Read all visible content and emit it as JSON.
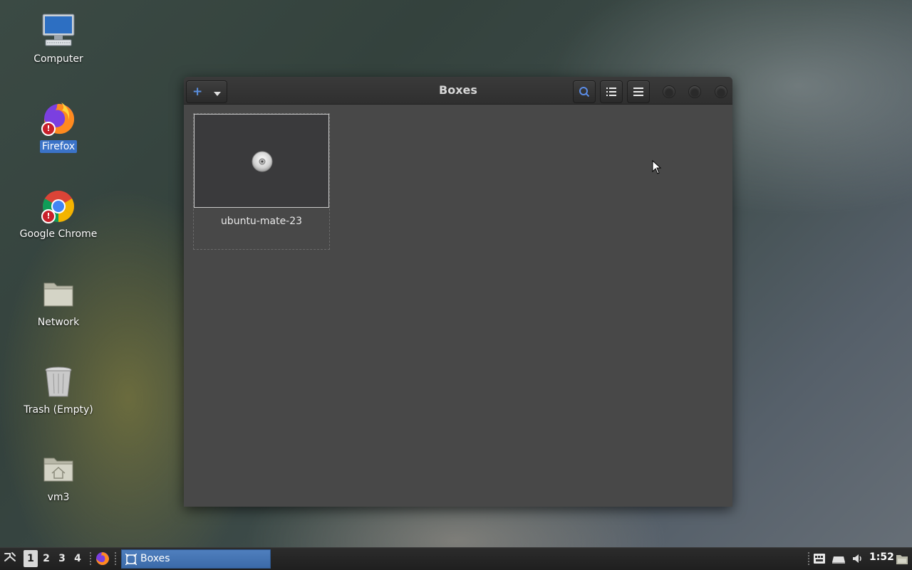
{
  "desktop": {
    "icons": [
      {
        "label": "Computer"
      },
      {
        "label": "Firefox"
      },
      {
        "label": "Google Chrome"
      },
      {
        "label": "Network"
      },
      {
        "label": "Trash (Empty)"
      },
      {
        "label": "vm3"
      }
    ]
  },
  "window": {
    "title": "Boxes",
    "new_button_icon": "plus-icon",
    "vm": {
      "name": "ubuntu-mate-23"
    }
  },
  "taskbar": {
    "workspaces": [
      "1",
      "2",
      "3",
      "4"
    ],
    "active_workspace": "1",
    "task_label": "Boxes",
    "clock": "1:52"
  },
  "colors": {
    "accent": "#3b73c8",
    "task_active": "#4f7fbe"
  }
}
